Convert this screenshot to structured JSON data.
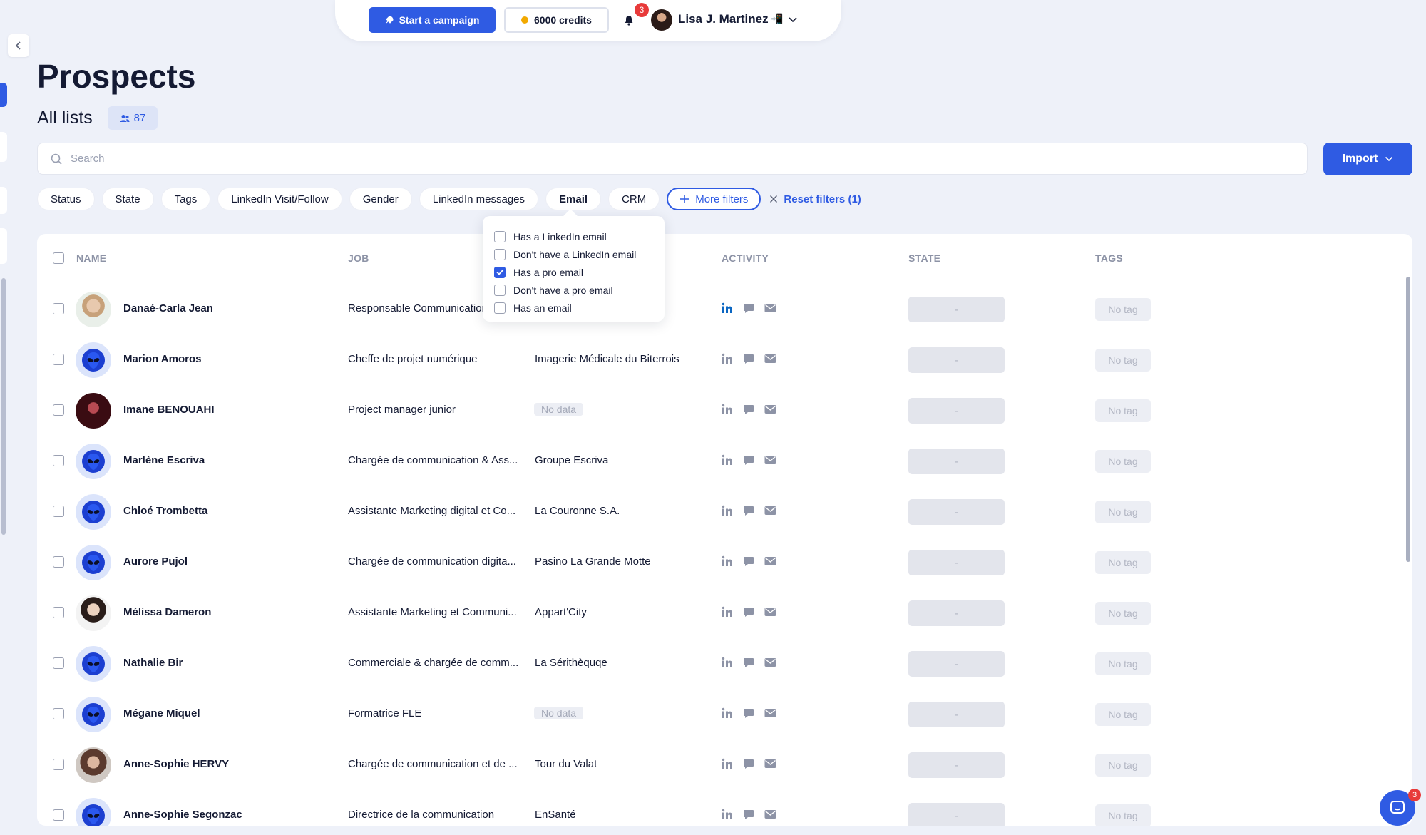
{
  "topbar": {
    "campaign_label": "Start a campaign",
    "credits_label": "6000 credits",
    "notification_count": "3",
    "user_name": "Lisa J. Martinez",
    "user_emoji": "📲"
  },
  "page": {
    "title": "Prospects",
    "lists_title": "All lists",
    "list_count": "87"
  },
  "search": {
    "placeholder": "Search"
  },
  "import_label": "Import",
  "filters": {
    "chips": [
      "Status",
      "State",
      "Tags",
      "LinkedIn Visit/Follow",
      "Gender",
      "LinkedIn messages",
      "Email",
      "CRM"
    ],
    "active": "Email",
    "more_label": "More filters",
    "reset_label": "Reset filters (1)"
  },
  "email_filter": {
    "options": [
      {
        "label": "Has a LinkedIn email",
        "checked": false
      },
      {
        "label": "Don't have a LinkedIn email",
        "checked": false
      },
      {
        "label": "Has a pro email",
        "checked": true
      },
      {
        "label": "Don't have a pro email",
        "checked": false
      },
      {
        "label": "Has an email",
        "checked": false
      }
    ]
  },
  "table": {
    "columns": [
      "NAME",
      "JOB",
      "ACTIVITY",
      "STATE",
      "TAGS"
    ],
    "rows": [
      {
        "name": "Danaé-Carla Jean",
        "job": "Responsable Communication",
        "company": "",
        "avatar": "photo1",
        "linkedin_active": true
      },
      {
        "name": "Marion Amoros",
        "job": "Cheffe de projet numérique",
        "company": "Imagerie Médicale du Biterrois",
        "avatar": "alien",
        "linkedin_active": false
      },
      {
        "name": "Imane BENOUAHI",
        "job": "Project manager junior",
        "company": "No data",
        "avatar": "photo2",
        "linkedin_active": false
      },
      {
        "name": "Marlène Escriva",
        "job": "Chargée de communication & Ass...",
        "company": "Groupe Escriva",
        "avatar": "alien",
        "linkedin_active": false
      },
      {
        "name": "Chloé Trombetta",
        "job": "Assistante Marketing digital et Co...",
        "company": "La Couronne S.A.",
        "avatar": "alien",
        "linkedin_active": false
      },
      {
        "name": "Aurore Pujol",
        "job": "Chargée de communication digita...",
        "company": "Pasino La Grande Motte",
        "avatar": "alien",
        "linkedin_active": false
      },
      {
        "name": "Mélissa Dameron",
        "job": "Assistante Marketing et Communi...",
        "company": "Appart'City",
        "avatar": "photo3",
        "linkedin_active": false
      },
      {
        "name": "Nathalie Bir",
        "job": "Commerciale & chargée de comm...",
        "company": "La Sérithèquqe",
        "avatar": "alien",
        "linkedin_active": false
      },
      {
        "name": "Mégane Miquel",
        "job": "Formatrice FLE",
        "company": "No data",
        "avatar": "alien",
        "linkedin_active": false
      },
      {
        "name": "Anne-Sophie HERVY",
        "job": "Chargée de communication et de ...",
        "company": "Tour du Valat",
        "avatar": "photo4",
        "linkedin_active": false
      },
      {
        "name": "Anne-Sophie Segonzac",
        "job": "Directrice de la communication",
        "company": "EnSanté",
        "avatar": "alien",
        "linkedin_active": false
      }
    ],
    "state_value": "-",
    "tag_value": "No tag"
  },
  "chat": {
    "badge": "3"
  },
  "colors": {
    "accent": "#2f5be3",
    "linkedin": "#0a66c2",
    "badge": "#e83a3a"
  },
  "icons": [
    "chevron-left-icon",
    "rocket-icon",
    "coin-icon",
    "bell-icon",
    "chevron-down-icon",
    "users-icon",
    "search-icon",
    "plus-icon",
    "close-icon",
    "linkedin-icon",
    "message-icon",
    "mail-icon",
    "chat-icon"
  ]
}
